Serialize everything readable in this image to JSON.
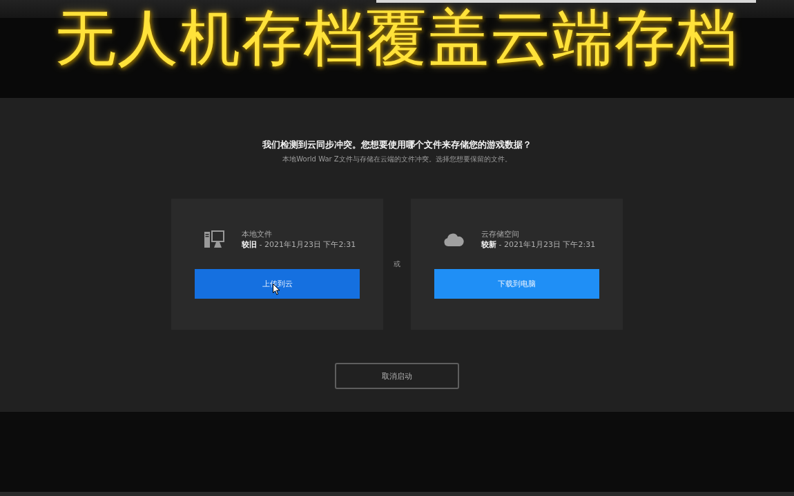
{
  "caption": "无人机存档覆盖云端存档",
  "dialog": {
    "title": "我们检测到云同步冲突。您想要使用哪个文件来存储您的游戏数据？",
    "subtitle": "本地World War Z文件与存储在云端的文件冲突。选择您想要保留的文件。",
    "options": [
      {
        "kind": "local",
        "label": "本地文件",
        "status": "**较旧** - 2021年1月23日 下午2:31",
        "button": {
          "label": "上传到云",
          "hovered": true
        }
      },
      {
        "kind": "cloud",
        "label": "云存储空间",
        "status": "**较新** - 2021年1月23日 下午2:31",
        "button": {
          "label": "下载到电脑",
          "hovered": false
        }
      }
    ],
    "separator": "或",
    "cancel_button": "取消启动"
  }
}
